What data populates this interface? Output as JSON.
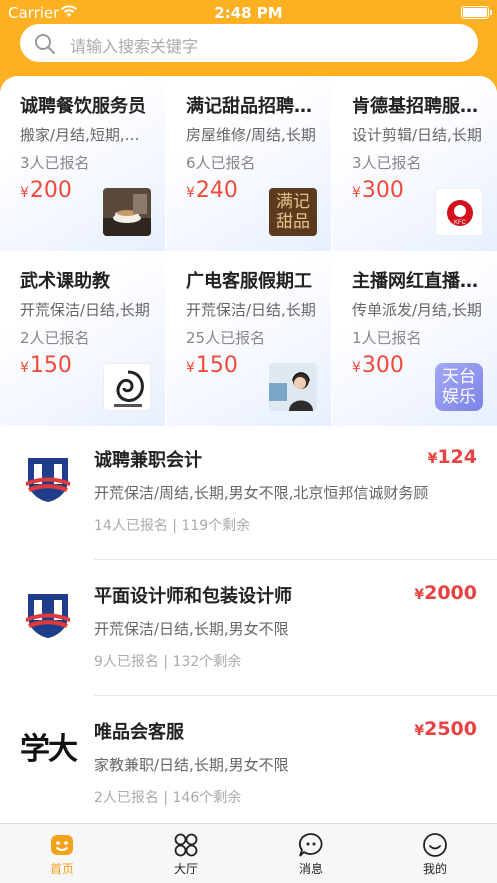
{
  "status": {
    "carrier": "Carrier",
    "time": "2:48 PM"
  },
  "search": {
    "placeholder": "请输入搜索关键字"
  },
  "cards": [
    {
      "title": "诚聘餐饮服务员",
      "desc": "搬家/月结,短期,男女不限",
      "signed": "3人已报名",
      "currency": "¥",
      "price": "200",
      "logo": "coffee-photo"
    },
    {
      "title": "满记甜品招聘店员",
      "desc": "房屋维修/周结,长期",
      "signed": "6人已报名",
      "currency": "¥",
      "price": "240",
      "logo": "manji-logo",
      "logo_text": "满记甜品"
    },
    {
      "title": "肯德基招聘服务员",
      "desc": "设计剪辑/日结,长期",
      "signed": "3人已报名",
      "currency": "¥",
      "price": "300",
      "logo": "kfc-logo",
      "logo_text": "KFC"
    },
    {
      "title": "武术课助教",
      "desc": "开荒保洁/日结,长期",
      "signed": "2人已报名",
      "currency": "¥",
      "price": "150",
      "logo": "dragon-logo"
    },
    {
      "title": "广电客服假期工",
      "desc": "开荒保洁/日结,长期",
      "signed": "25人已报名",
      "currency": "¥",
      "price": "150",
      "logo": "headset-photo"
    },
    {
      "title": "主播网红直播助理",
      "desc": "传单派发/月结,长期",
      "signed": "1人已报名",
      "currency": "¥",
      "price": "300",
      "logo": "tiantai-logo",
      "logo_text": "天台娱乐"
    }
  ],
  "list": [
    {
      "title": "诚聘兼职会计",
      "currency": "¥",
      "price": "124",
      "desc": "开荒保洁/周结,长期,男女不限,北京恒邦信诚财务顾",
      "stats": "14人已报名 | 119个剩余",
      "logo": "shield-logo"
    },
    {
      "title": "平面设计师和包装设计师",
      "currency": "¥",
      "price": "2000",
      "desc": "开荒保洁/日结,长期,男女不限",
      "stats": "9人已报名 | 132个剩余",
      "logo": "shield-logo"
    },
    {
      "title": "唯品会客服",
      "currency": "¥",
      "price": "2500",
      "desc": "家教兼职/日结,长期,男女不限",
      "stats": "2人已报名 | 146个剩余",
      "logo": "xueda-logo",
      "logo_text": "学大"
    }
  ],
  "tabs": [
    {
      "label": "首页",
      "icon": "home-icon",
      "active": true
    },
    {
      "label": "大厅",
      "icon": "grid-icon",
      "active": false
    },
    {
      "label": "消息",
      "icon": "chat-icon",
      "active": false
    },
    {
      "label": "我的",
      "icon": "profile-icon",
      "active": false
    }
  ],
  "colors": {
    "accent": "#fdb022",
    "price": "#f04a3a",
    "tab_active": "#f4a21b"
  }
}
